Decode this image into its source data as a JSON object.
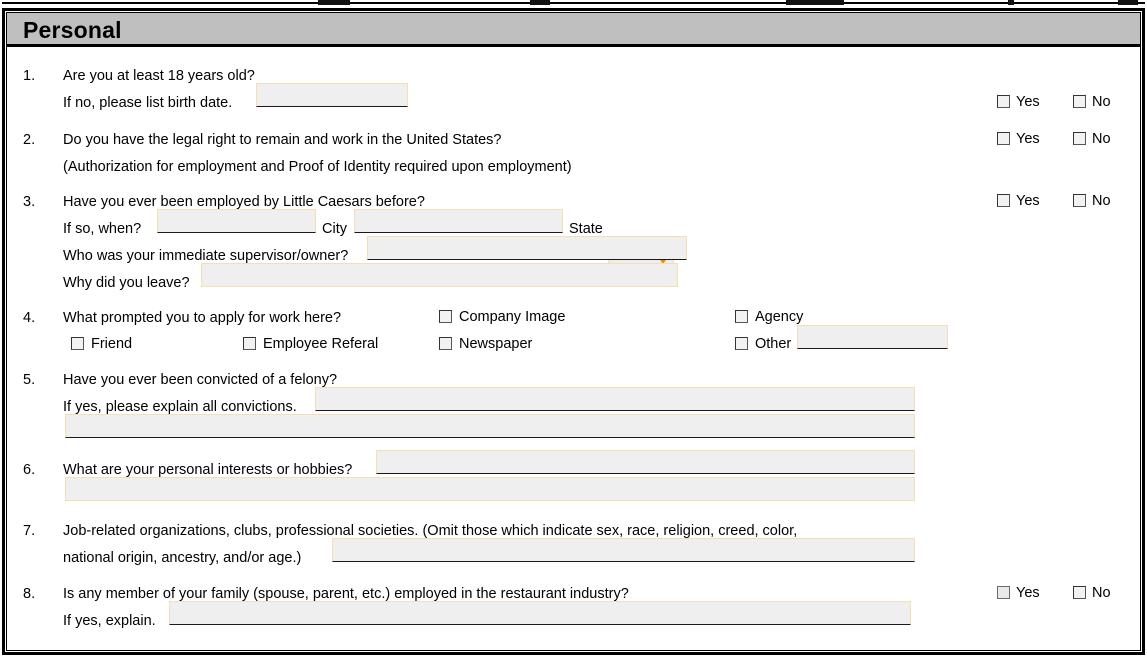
{
  "section": {
    "title": "Personal"
  },
  "yes_no": {
    "yes_label": "Yes",
    "no_label": "No"
  },
  "questions": [
    {
      "number": "1.",
      "text": "Are you at least 18 years old?",
      "sub_text": "If no, please list birth date.",
      "has_yes_no": true
    },
    {
      "number": "2.",
      "text": "Do you have the legal right to remain and work in the United States?",
      "sub_text": "(Authorization for employment and Proof of Identity required upon employment)",
      "has_yes_no": true
    },
    {
      "number": "3.",
      "text": "Have you ever been employed by Little Caesars before?",
      "when_label": "If so, when?",
      "city_label": "City",
      "state_label": "State",
      "state_value": "",
      "supervisor_label": "Who was your immediate supervisor/owner?",
      "why_leave_label": "Why did you leave?",
      "has_yes_no": true
    },
    {
      "number": "4.",
      "text": "What prompted you to apply for work here?",
      "options": [
        "Company Image",
        "Agency",
        "Friend",
        "Employee Referal",
        "Newspaper",
        "Other"
      ],
      "has_yes_no": false
    },
    {
      "number": "5.",
      "text": "Have you ever been convicted of a felony?",
      "sub_text": "If yes, please explain all convictions.",
      "has_yes_no": true
    },
    {
      "number": "6.",
      "text": "What are your personal interests or hobbies?",
      "has_yes_no": false
    },
    {
      "number": "7.",
      "text": "Job-related organizations, clubs, professional societies. (Omit those which indicate sex, race, religion, creed, color,",
      "sub_text": "national origin, ancestry, and/or age.)",
      "has_yes_no": false
    },
    {
      "number": "8.",
      "text": "Is any member of your family (spouse, parent, etc.) employed in the restaurant industry?",
      "sub_text": "If yes, explain.",
      "has_yes_no": true
    }
  ],
  "field_values": {
    "birth_date": "",
    "when": "",
    "city": "",
    "supervisor": "",
    "why_leave": "",
    "other_source": "",
    "convictions_line1": "",
    "convictions_line2": "",
    "hobbies_line1": "",
    "hobbies_line2": "",
    "organizations": "",
    "family_explain": ""
  },
  "colors": {
    "header_bg": "#bfbfbf",
    "field_bg": "#efefef",
    "field_border": "#f7dcb4",
    "underline": "#1a1a1a",
    "caret": "#f08c00",
    "frame": "#000000"
  }
}
